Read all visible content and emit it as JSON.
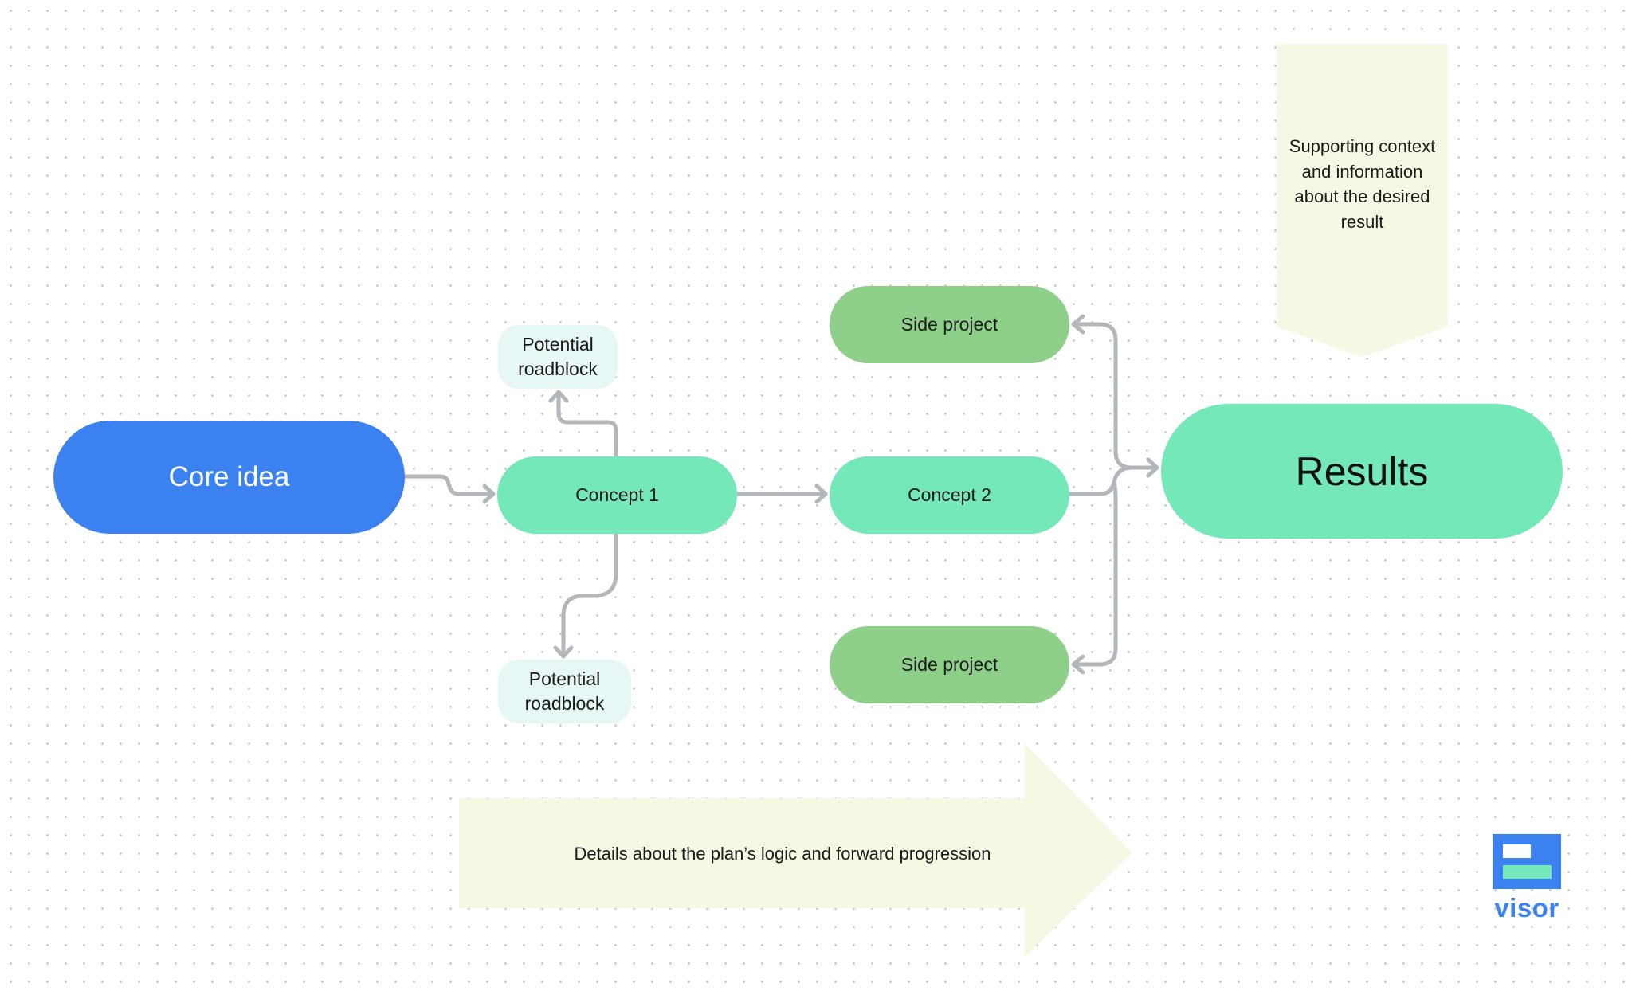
{
  "diagram": {
    "core_idea": {
      "label": "Core idea",
      "color": "#3b82f0"
    },
    "concepts": [
      {
        "label": "Concept 1",
        "color": "#74e8b8"
      },
      {
        "label": "Concept 2",
        "color": "#74e8b8"
      }
    ],
    "roadblocks": [
      {
        "line1": "Potential",
        "line2": "roadblock",
        "color": "#e6f7f5"
      },
      {
        "line1": "Potential",
        "line2": "roadblock",
        "color": "#e6f7f5"
      }
    ],
    "side_projects": [
      {
        "label": "Side project",
        "color": "#8ed08a"
      },
      {
        "label": "Side project",
        "color": "#8ed08a"
      }
    ],
    "results": {
      "label": "Results",
      "color": "#74e8b8"
    },
    "context_banner": {
      "lines": [
        "Supporting context",
        "and information",
        "about the desired",
        "result"
      ],
      "color": "#f4f9e3"
    },
    "progress_arrow": {
      "label": "Details about the plan’s logic and forward progression",
      "color": "#f4f9e3"
    },
    "connector_color": "#b3b6ba",
    "edges": [
      {
        "from": "Core idea",
        "to": "Concept 1"
      },
      {
        "from": "Concept 1",
        "to": "Potential roadblock (top)"
      },
      {
        "from": "Concept 1",
        "to": "Potential roadblock (bottom)"
      },
      {
        "from": "Concept 1",
        "to": "Concept 2"
      },
      {
        "from": "Concept 2",
        "to": "Results"
      },
      {
        "from": "Concept 2",
        "to": "Side project (top)"
      },
      {
        "from": "Concept 2",
        "to": "Side project (bottom)"
      }
    ]
  },
  "logo": {
    "text": "visor",
    "brand_color": "#3b82f0",
    "accent_color": "#74e8b8"
  }
}
